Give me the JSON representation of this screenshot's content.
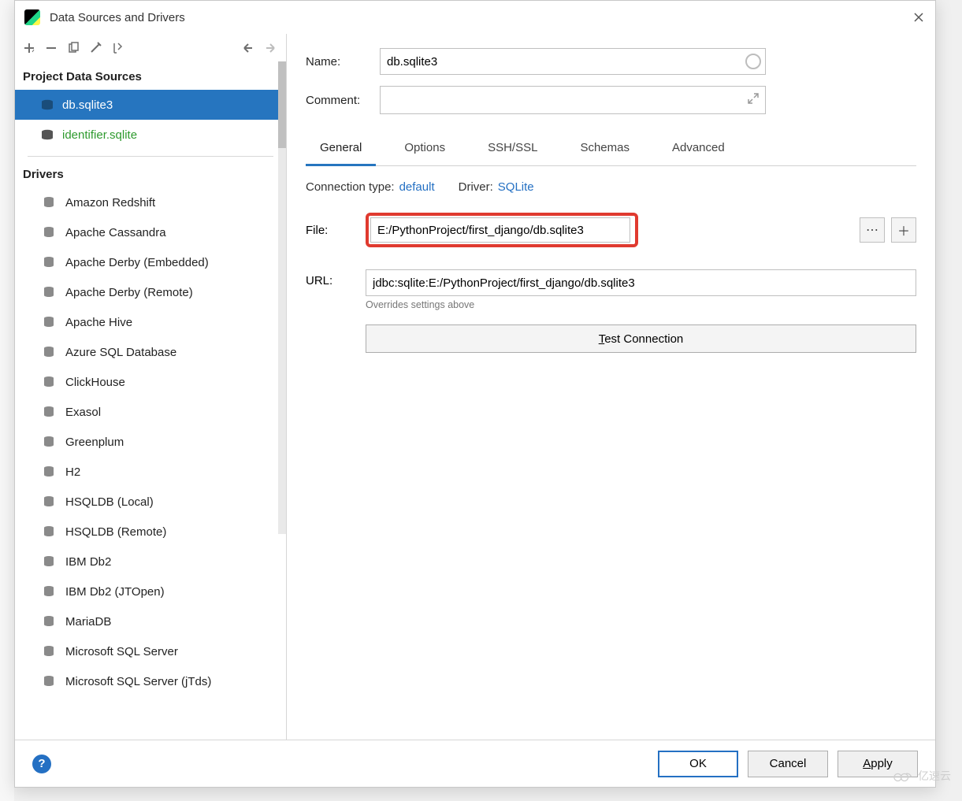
{
  "window": {
    "title": "Data Sources and Drivers"
  },
  "left": {
    "project_header": "Project Data Sources",
    "drivers_header": "Drivers",
    "data_sources": [
      {
        "label": "db.sqlite3",
        "selected": true
      },
      {
        "label": "identifier.sqlite",
        "changed": true
      }
    ],
    "drivers": [
      "Amazon Redshift",
      "Apache Cassandra",
      "Apache Derby (Embedded)",
      "Apache Derby (Remote)",
      "Apache Hive",
      "Azure SQL Database",
      "ClickHouse",
      "Exasol",
      "Greenplum",
      "H2",
      "HSQLDB (Local)",
      "HSQLDB (Remote)",
      "IBM Db2",
      "IBM Db2 (JTOpen)",
      "MariaDB",
      "Microsoft SQL Server",
      "Microsoft SQL Server (jTds)"
    ]
  },
  "form": {
    "name_label": "Name:",
    "name_value": "db.sqlite3",
    "comment_label": "Comment:",
    "tabs": [
      "General",
      "Options",
      "SSH/SSL",
      "Schemas",
      "Advanced"
    ],
    "active_tab": 0,
    "conn_type_label": "Connection type:",
    "conn_type_value": "default",
    "driver_label": "Driver:",
    "driver_value": "SQLite",
    "file_label": "File:",
    "file_value": "E:/PythonProject/first_django/db.sqlite3",
    "url_label": "URL:",
    "url_value": "jdbc:sqlite:E:/PythonProject/first_django/db.sqlite3",
    "url_hint": "Overrides settings above",
    "test_button_prefix": "T",
    "test_button_rest": "est Connection"
  },
  "footer": {
    "ok": "OK",
    "cancel": "Cancel",
    "apply_prefix": "A",
    "apply_rest": "pply"
  },
  "watermark": "亿速云"
}
